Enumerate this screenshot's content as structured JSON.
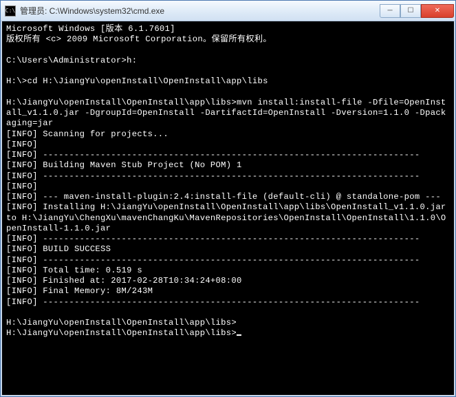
{
  "titlebar": {
    "icon_label": "C:\\",
    "title": "管理员: C:\\Windows\\system32\\cmd.exe"
  },
  "win_controls": {
    "minimize": "─",
    "maximize": "☐",
    "close": "✕"
  },
  "console": {
    "line1": "Microsoft Windows [版本 6.1.7601]",
    "line2": "版权所有 <c> 2009 Microsoft Corporation。保留所有权利。",
    "blank": "",
    "prompt1": "C:\\Users\\Administrator>h:",
    "prompt2": "H:\\>cd H:\\JiangYu\\openInstall\\OpenInstall\\app\\libs",
    "cmd_line": "H:\\JiangYu\\openInstall\\OpenInstall\\app\\libs>mvn install:install-file -Dfile=OpenInstall_v1.1.0.jar -DgroupId=OpenInstall -DartifactId=OpenInstall -Dversion=1.1.0 -Dpackaging=jar",
    "info_scan": "[INFO] Scanning for projects...",
    "info_blank": "[INFO]",
    "info_sep": "[INFO] ------------------------------------------------------------------------",
    "info_build": "[INFO] Building Maven Stub Project (No POM) 1",
    "info_plugin": "[INFO] --- maven-install-plugin:2.4:install-file (default-cli) @ standalone-pom ---",
    "info_install": "[INFO] Installing H:\\JiangYu\\openInstall\\OpenInstall\\app\\libs\\OpenInstall_v1.1.0.jar to H:\\JiangYu\\ChengXu\\mavenChangKu\\MavenRepositories\\OpenInstall\\OpenInstall\\1.1.0\\OpenInstall-1.1.0.jar",
    "info_success": "[INFO] BUILD SUCCESS",
    "info_time": "[INFO] Total time: 0.519 s",
    "info_finished": "[INFO] Finished at: 2017-02-28T10:34:24+08:00",
    "info_memory": "[INFO] Final Memory: 8M/243M",
    "prompt3": "H:\\JiangYu\\openInstall\\OpenInstall\\app\\libs>",
    "prompt4": "H:\\JiangYu\\openInstall\\OpenInstall\\app\\libs>"
  }
}
